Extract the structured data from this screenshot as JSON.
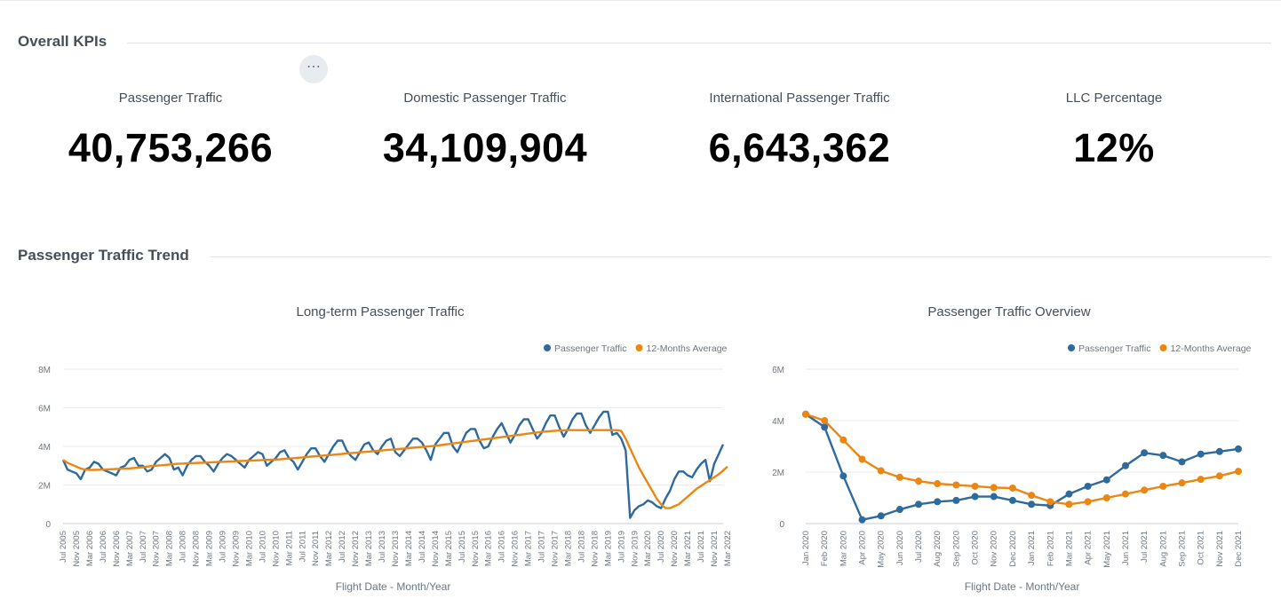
{
  "sections": {
    "overall": "Overall KPIs",
    "trend": "Passenger Traffic Trend"
  },
  "kpis": [
    {
      "label": "Passenger Traffic",
      "value": "40,753,266"
    },
    {
      "label": "Domestic Passenger Traffic",
      "value": "34,109,904"
    },
    {
      "label": "International Passenger Traffic",
      "value": "6,643,362"
    },
    {
      "label": "LLC Percentage",
      "value": "12%"
    }
  ],
  "menu_icon": "more-horizontal-icon",
  "menu_glyph": "⋯",
  "colors": {
    "series1": "#2e6a9c",
    "series2": "#ec8613",
    "grid": "#ebebeb",
    "axis_text": "#6d7680"
  },
  "chart_data": [
    {
      "type": "line",
      "title": "Long-term Passenger Traffic",
      "xlabel": "Flight Date - Month/Year",
      "ylabel": "",
      "yticks": [
        "0",
        "2M",
        "4M",
        "6M",
        "8M"
      ],
      "ylim": [
        0,
        8000000
      ],
      "legend": "top-right",
      "grid": true,
      "x": [
        "Jul 2005",
        "Nov 2005",
        "Mar 2006",
        "Jul 2006",
        "Nov 2006",
        "Mar 2007",
        "Jul 2007",
        "Nov 2007",
        "Mar 2008",
        "Jul 2008",
        "Nov 2008",
        "Mar 2009",
        "Jul 2009",
        "Nov 2009",
        "Mar 2010",
        "Jul 2010",
        "Nov 2010",
        "Mar 2011",
        "Jul 2011",
        "Nov 2011",
        "Mar 2012",
        "Jul 2012",
        "Nov 2012",
        "Mar 2013",
        "Jul 2013",
        "Nov 2013",
        "Mar 2014",
        "Jul 2014",
        "Nov 2014",
        "Mar 2015",
        "Jul 2015",
        "Nov 2015",
        "Mar 2016",
        "Jul 2016",
        "Nov 2016",
        "Mar 2017",
        "Jul 2017",
        "Nov 2017",
        "Mar 2018",
        "Jul 2018",
        "Nov 2018",
        "Mar 2019",
        "Jul 2019",
        "Nov 2019",
        "Mar 2020",
        "Jul 2020",
        "Nov 2020",
        "Mar 2021",
        "Jul 2021",
        "Nov 2021",
        "Mar 2022"
      ],
      "series": [
        {
          "name": "Passenger Traffic",
          "values": [
            3300000,
            2800000,
            2700000,
            2600000,
            2300000,
            2800000,
            2900000,
            3200000,
            3100000,
            2800000,
            2700000,
            2600000,
            2500000,
            2900000,
            3000000,
            3300000,
            3400000,
            3000000,
            3000000,
            2700000,
            2800000,
            3200000,
            3400000,
            3600000,
            3400000,
            2800000,
            2900000,
            2500000,
            3000000,
            3300000,
            3500000,
            3500000,
            3200000,
            3000000,
            2700000,
            3100000,
            3400000,
            3600000,
            3500000,
            3300000,
            3100000,
            2900000,
            3300000,
            3500000,
            3700000,
            3600000,
            3000000,
            3200000,
            3400000,
            3700000,
            3800000,
            3400000,
            3200000,
            2800000,
            3200000,
            3600000,
            3900000,
            3900000,
            3500000,
            3200000,
            3600000,
            4000000,
            4300000,
            4300000,
            3800000,
            3500000,
            3300000,
            3700000,
            4100000,
            4200000,
            3800000,
            3600000,
            4000000,
            4300000,
            4400000,
            3700000,
            3500000,
            3800000,
            4100000,
            4400000,
            4400000,
            4200000,
            3800000,
            3300000,
            4100000,
            4400000,
            4700000,
            4700000,
            4000000,
            3700000,
            4200000,
            4700000,
            4900000,
            4900000,
            4300000,
            3900000,
            4000000,
            4500000,
            4900000,
            5200000,
            4700000,
            4200000,
            4600000,
            5100000,
            5400000,
            5400000,
            4900000,
            4400000,
            4700000,
            5200000,
            5600000,
            5600000,
            5000000,
            4500000,
            4900000,
            5400000,
            5700000,
            5700000,
            5100000,
            4700000,
            5100000,
            5500000,
            5800000,
            5800000,
            4600000,
            4700000,
            4400000,
            3800000,
            300000,
            700000,
            900000,
            1000000,
            1200000,
            1100000,
            900000,
            800000,
            1300000,
            1700000,
            2300000,
            2700000,
            2700000,
            2500000,
            2400000,
            2800000,
            3100000,
            3300000,
            2200000,
            3100000,
            3600000,
            4100000
          ]
        },
        {
          "name": "12-Months Average",
          "values": [
            3300000,
            3150000,
            3050000,
            2950000,
            2850000,
            2800000,
            2780000,
            2780000,
            2790000,
            2800000,
            2810000,
            2820000,
            2830000,
            2840000,
            2850000,
            2860000,
            2880000,
            2900000,
            2920000,
            2950000,
            2980000,
            3000000,
            3020000,
            3040000,
            3060000,
            3080000,
            3100000,
            3110000,
            3120000,
            3130000,
            3140000,
            3150000,
            3160000,
            3170000,
            3180000,
            3190000,
            3200000,
            3210000,
            3220000,
            3230000,
            3240000,
            3250000,
            3260000,
            3270000,
            3280000,
            3290000,
            3300000,
            3310000,
            3320000,
            3330000,
            3350000,
            3370000,
            3390000,
            3410000,
            3430000,
            3450000,
            3470000,
            3490000,
            3510000,
            3530000,
            3550000,
            3570000,
            3590000,
            3610000,
            3630000,
            3650000,
            3670000,
            3690000,
            3710000,
            3730000,
            3750000,
            3770000,
            3790000,
            3810000,
            3830000,
            3850000,
            3870000,
            3890000,
            3910000,
            3930000,
            3950000,
            3970000,
            3990000,
            4010000,
            4030000,
            4060000,
            4090000,
            4120000,
            4150000,
            4180000,
            4210000,
            4240000,
            4270000,
            4300000,
            4330000,
            4360000,
            4390000,
            4420000,
            4450000,
            4480000,
            4510000,
            4540000,
            4570000,
            4600000,
            4630000,
            4660000,
            4690000,
            4720000,
            4750000,
            4770000,
            4790000,
            4810000,
            4820000,
            4830000,
            4840000,
            4840000,
            4840000,
            4840000,
            4840000,
            4840000,
            4840000,
            4840000,
            4840000,
            4840000,
            4840000,
            4840000,
            4800000,
            4400000,
            3900000,
            3400000,
            2900000,
            2500000,
            2100000,
            1700000,
            1300000,
            1000000,
            800000,
            800000,
            900000,
            1000000,
            1200000,
            1400000,
            1600000,
            1800000,
            1950000,
            2100000,
            2250000,
            2400000,
            2550000,
            2750000,
            2950000
          ]
        }
      ]
    },
    {
      "type": "line",
      "title": "Passenger Traffic Overview",
      "xlabel": "Flight Date - Month/Year",
      "ylabel": "",
      "yticks": [
        "0",
        "2M",
        "4M",
        "6M"
      ],
      "ylim": [
        0,
        6000000
      ],
      "legend": "top-right",
      "grid": true,
      "categories": [
        "Jan 2020",
        "Feb 2020",
        "Mar 2020",
        "Apr 2020",
        "May 2020",
        "Jun 2020",
        "Jul 2020",
        "Aug 2020",
        "Sep 2020",
        "Oct 2020",
        "Nov 2020",
        "Dec 2020",
        "Jan 2021",
        "Feb 2021",
        "Mar 2021",
        "Apr 2021",
        "May 2021",
        "Jun 2021",
        "Jul 2021",
        "Aug 2021",
        "Sep 2021",
        "Oct 2021",
        "Nov 2021",
        "Dec 2021"
      ],
      "series": [
        {
          "name": "Passenger Traffic",
          "values": [
            4250000,
            3750000,
            1850000,
            150000,
            300000,
            550000,
            750000,
            850000,
            900000,
            1050000,
            1050000,
            900000,
            750000,
            700000,
            1150000,
            1450000,
            1700000,
            2250000,
            2750000,
            2650000,
            2400000,
            2700000,
            2800000,
            2900000
          ]
        },
        {
          "name": "12-Months Average",
          "values": [
            4250000,
            4000000,
            3250000,
            2500000,
            2050000,
            1800000,
            1650000,
            1550000,
            1500000,
            1450000,
            1400000,
            1380000,
            1100000,
            850000,
            750000,
            850000,
            1000000,
            1150000,
            1300000,
            1450000,
            1580000,
            1720000,
            1850000,
            2030000
          ]
        }
      ]
    }
  ]
}
